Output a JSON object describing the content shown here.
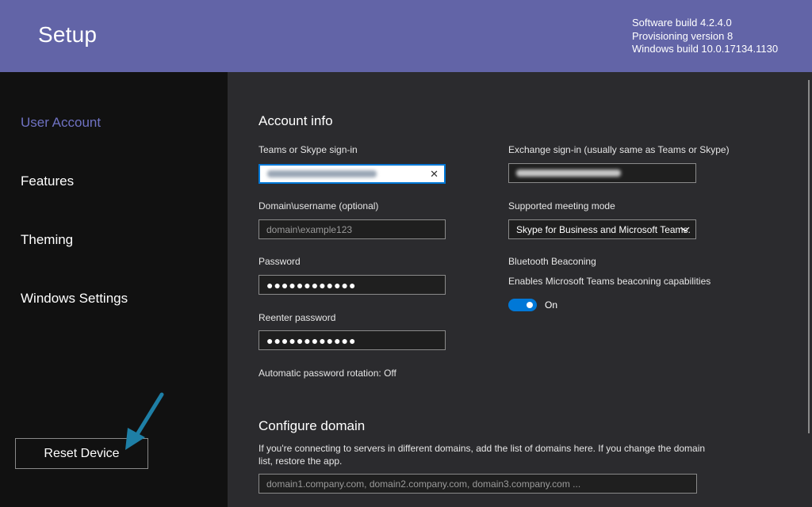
{
  "header": {
    "title": "Setup",
    "build_lines": [
      "Software build 4.2.4.0",
      "Provisioning version 8",
      "Windows build 10.0.17134.1130"
    ]
  },
  "sidebar": {
    "items": [
      {
        "label": "User Account",
        "active": true
      },
      {
        "label": "Features",
        "active": false
      },
      {
        "label": "Theming",
        "active": false
      },
      {
        "label": "Windows Settings",
        "active": false
      }
    ],
    "reset_label": "Reset Device"
  },
  "account": {
    "title": "Account info",
    "signin_label": "Teams or Skype sign-in",
    "domain_label": "Domain\\username (optional)",
    "domain_placeholder": "domain\\example123",
    "password_label": "Password",
    "password_dots": "●●●●●●●●●●●●",
    "reenter_label": "Reenter password",
    "reenter_dots": "●●●●●●●●●●●●",
    "rotation_text": "Automatic password rotation: Off",
    "exchange_label": "Exchange sign-in (usually same as Teams or Skype)",
    "mode_label": "Supported meeting mode",
    "mode_value": "Skype for Business and Microsoft Teams.",
    "beacon_title": "Bluetooth Beaconing",
    "beacon_desc": "Enables Microsoft Teams beaconing capabilities",
    "beacon_state": "On"
  },
  "domain": {
    "title": "Configure domain",
    "desc": "If you're connecting to servers in different domains, add the list of domains here. If you change the domain list, restore the app.",
    "placeholder": "domain1.company.com, domain2.company.com, domain3.company.com ..."
  },
  "colors": {
    "header_bg": "#6264a7",
    "sidebar_bg": "#111111",
    "main_bg": "#2b2b2e",
    "accent": "#0078d7",
    "active_nav": "#6f72c2",
    "arrow": "#1e7fa6"
  }
}
